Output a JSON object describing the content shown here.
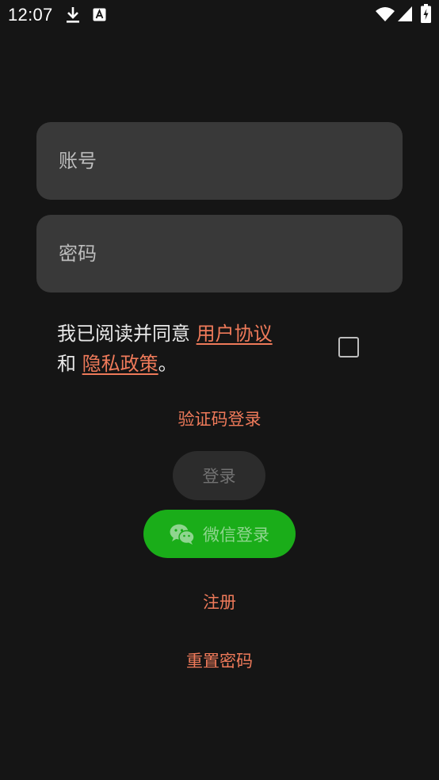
{
  "status_bar": {
    "time": "12:07",
    "icons": [
      "download-icon",
      "app-a-icon",
      "wifi-icon",
      "signal-icon",
      "battery-charging-icon"
    ]
  },
  "form": {
    "account_placeholder": "账号",
    "account_value": "",
    "password_placeholder": "密码",
    "password_value": ""
  },
  "agreement": {
    "prefix": "我已阅读并同意 ",
    "user_agreement": "用户协议",
    "and": "和 ",
    "privacy_policy": "隐私政策",
    "suffix": "。",
    "checked": false
  },
  "actions": {
    "sms_login": "验证码登录",
    "login": "登录",
    "wechat_login": "微信登录",
    "register": "注册",
    "reset_password": "重置密码"
  },
  "colors": {
    "background": "#151515",
    "field_bg": "#393939",
    "accent": "#ef7a5a",
    "wechat_green": "#1aad19",
    "login_disabled_bg": "#2c2c2c"
  }
}
